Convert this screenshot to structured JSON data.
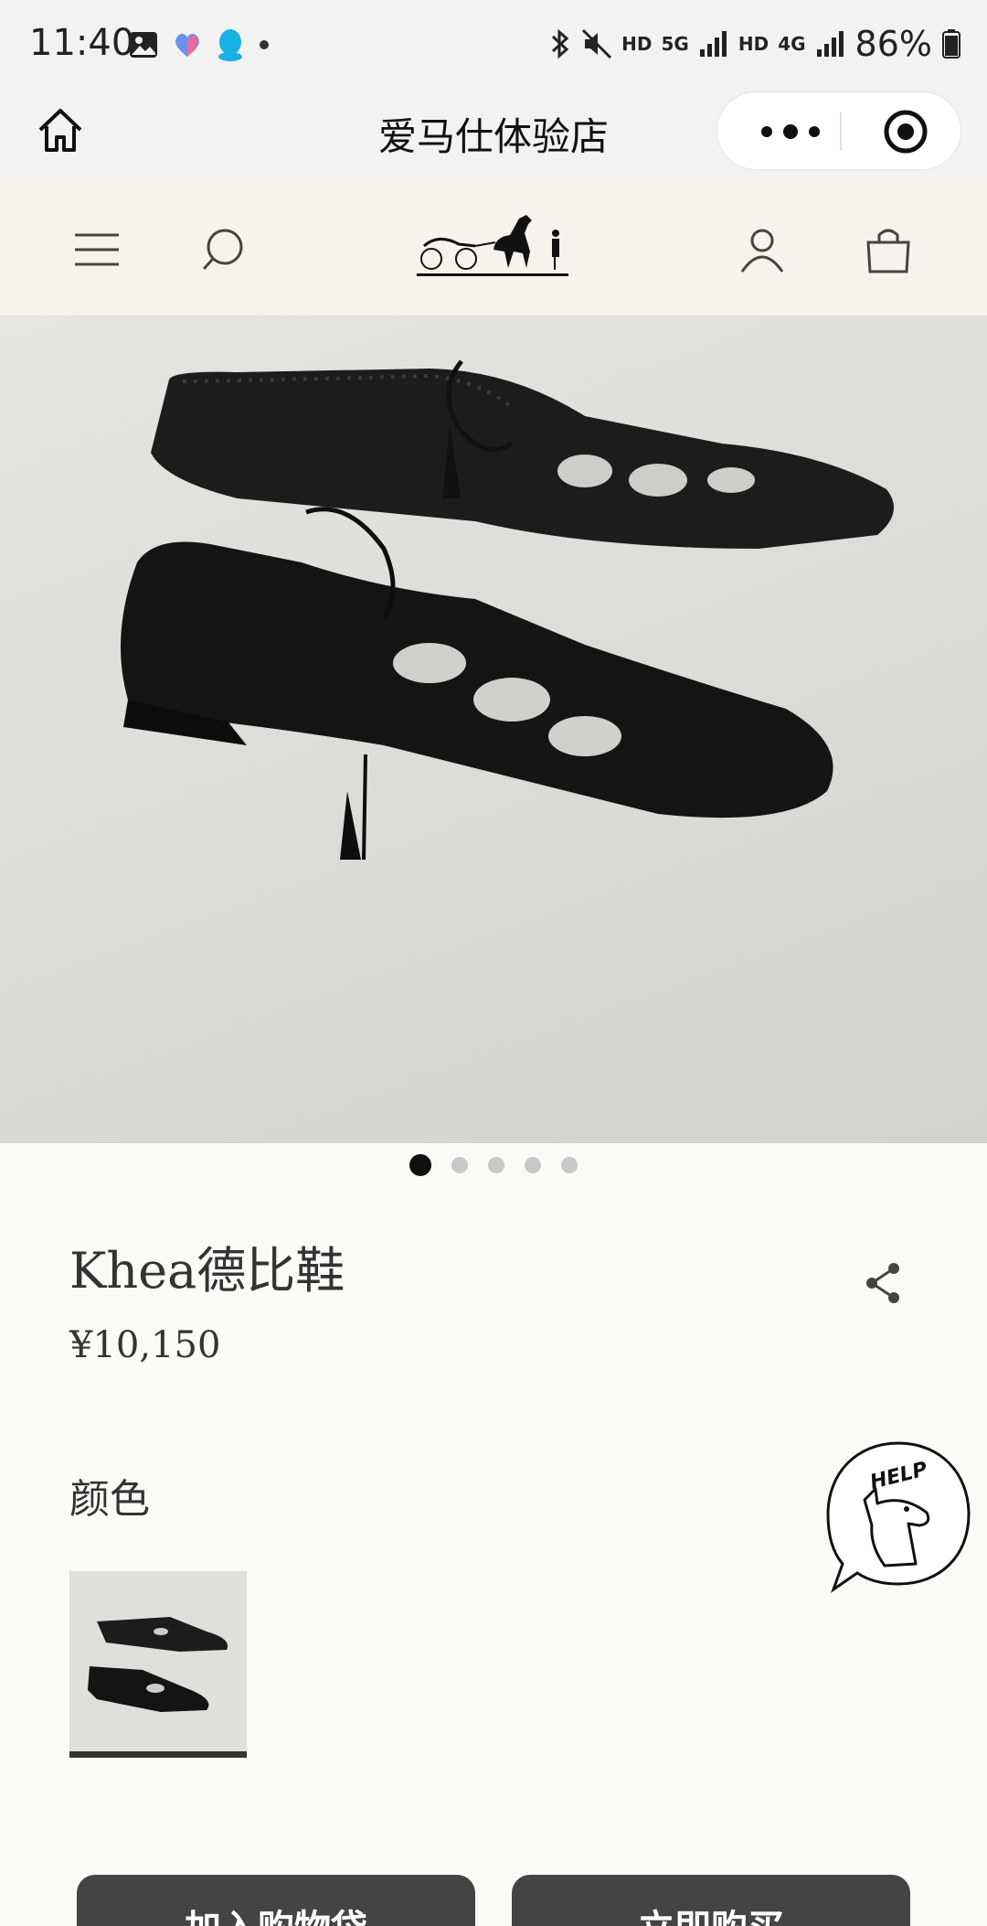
{
  "status_bar": {
    "time": "11:40",
    "hd1": "HD",
    "net5g": "5G",
    "hd2": "HD",
    "net4g": "4G",
    "battery": "86%",
    "icons": [
      "gallery-icon",
      "heart-app-icon",
      "qq-icon",
      "bluetooth-icon",
      "mute-icon",
      "signal-icon",
      "battery-icon"
    ]
  },
  "title_bar": {
    "title": "爱马仕体验店"
  },
  "header": {
    "icons": [
      "menu-icon",
      "search-icon",
      "hermes-logo",
      "account-icon",
      "bag-icon"
    ]
  },
  "carousel": {
    "total": 5,
    "active": 1
  },
  "product": {
    "name": "Khea德比鞋",
    "price": "¥10,150",
    "color_label": "颜色"
  },
  "help": {
    "label": "HELP"
  },
  "actions": {
    "add_to_bag": "加入购物袋",
    "buy_now": "立即购买"
  }
}
